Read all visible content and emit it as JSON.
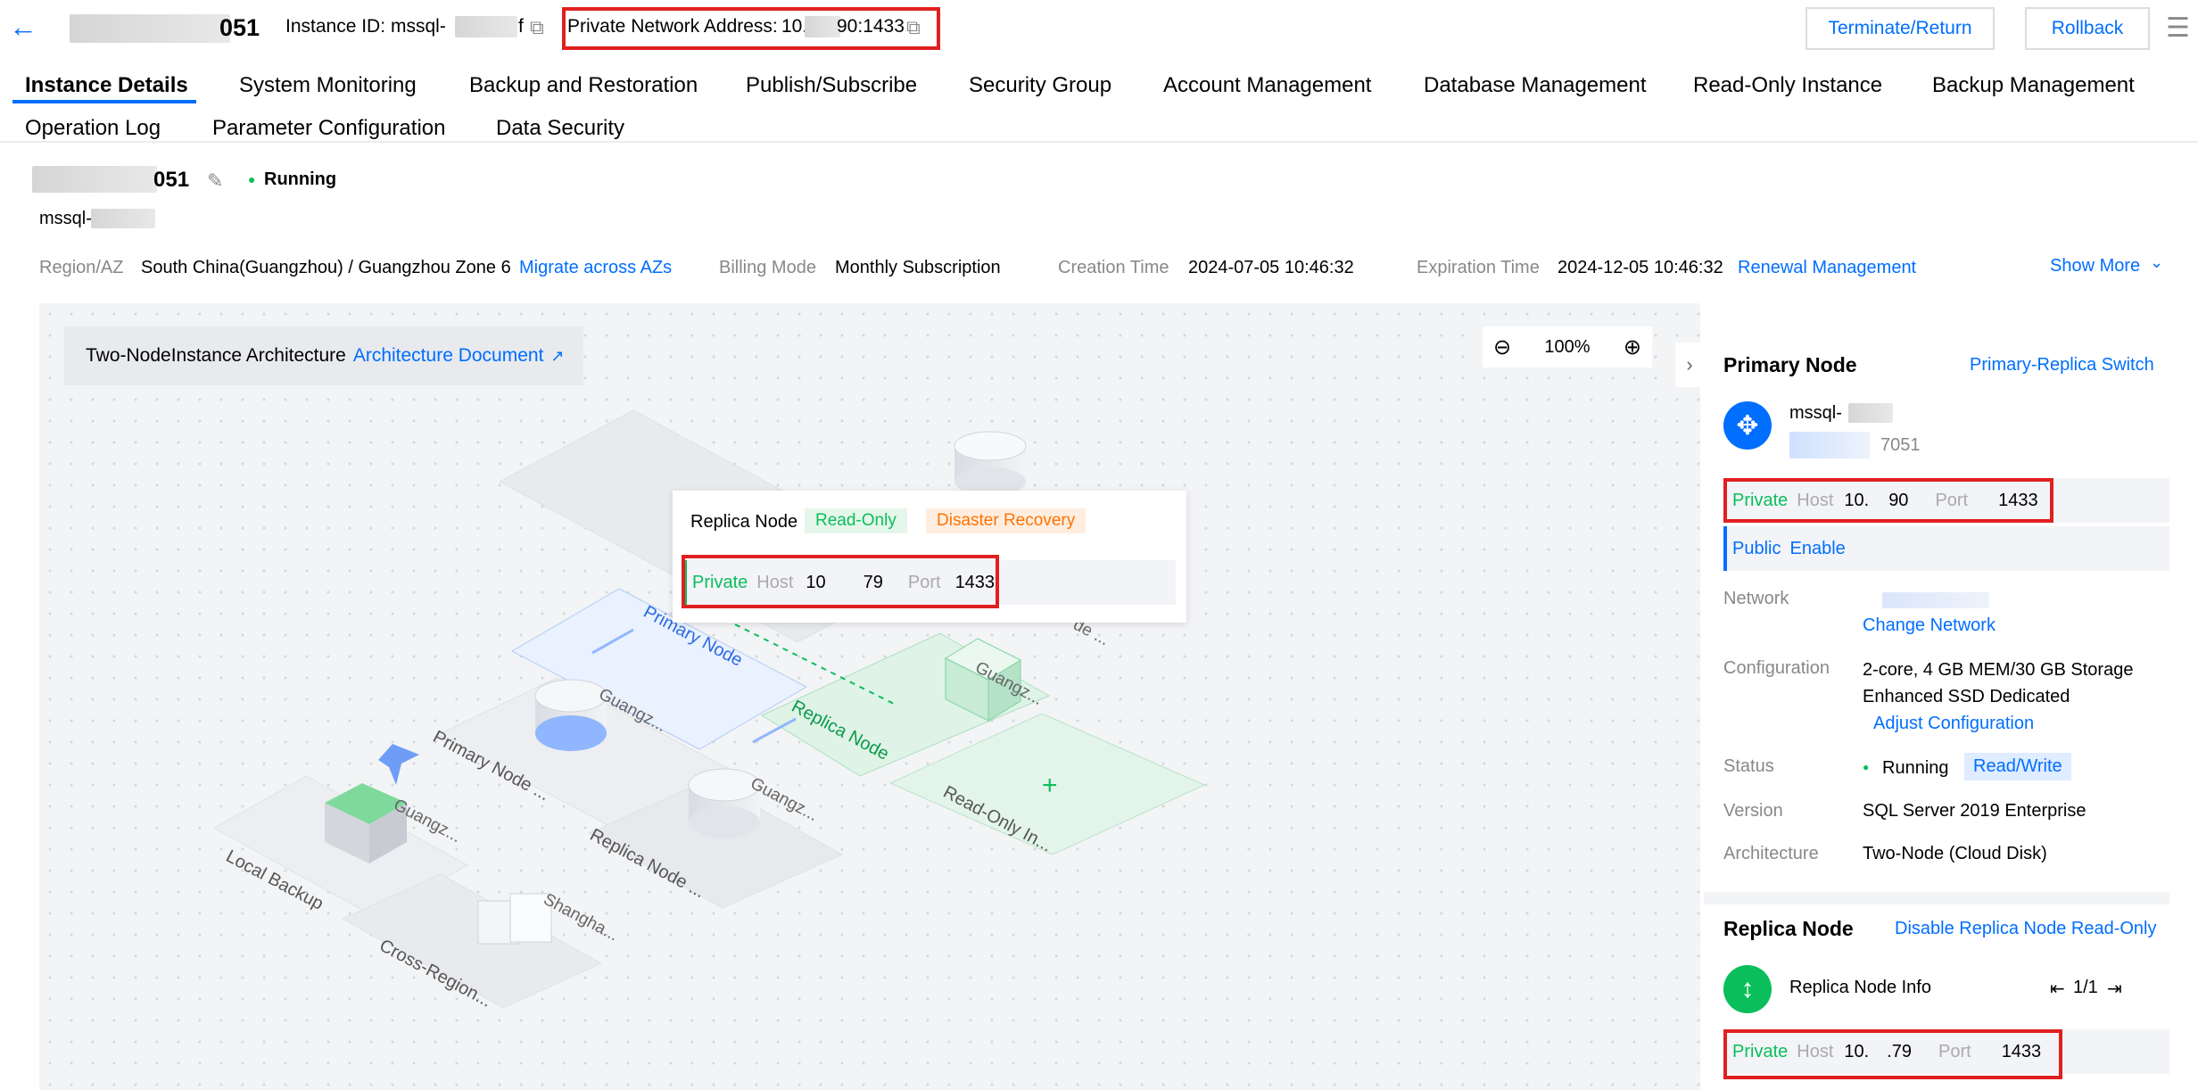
{
  "header": {
    "instance_name": "051",
    "instance_id_label": "Instance ID:",
    "instance_id_value": "mssql-",
    "instance_id_tail": "f",
    "private_address_label": "Private Network Address:",
    "private_address_prefix": "10.",
    "private_address_suffix": "90:1433",
    "terminate_button": "Terminate/Return",
    "rollback_button": "Rollback"
  },
  "tabs": [
    {
      "label": "Instance Details",
      "active": true
    },
    {
      "label": "System Monitoring"
    },
    {
      "label": "Backup and Restoration"
    },
    {
      "label": "Publish/Subscribe"
    },
    {
      "label": "Security Group"
    },
    {
      "label": "Account Management"
    },
    {
      "label": "Database Management"
    },
    {
      "label": "Read-Only Instance"
    },
    {
      "label": "Backup Management"
    },
    {
      "label": "Operation Log"
    },
    {
      "label": "Parameter Configuration"
    },
    {
      "label": "Data Security"
    }
  ],
  "summary": {
    "name_suffix": "051",
    "status": "Running",
    "sub_id": "mssql-",
    "region_label": "Region/AZ",
    "region_value": "South China(Guangzhou) / Guangzhou Zone 6",
    "migrate_link": "Migrate across AZs",
    "billing_label": "Billing Mode",
    "billing_value": "Monthly Subscription",
    "creation_label": "Creation Time",
    "creation_value": "2024-07-05 10:46:32",
    "expiration_label": "Expiration Time",
    "expiration_value": "2024-12-05 10:46:32",
    "renewal_link": "Renewal Management",
    "show_more": "Show More"
  },
  "diagram": {
    "arch_title": "Two-NodeInstance Architecture",
    "arch_doc_link": "Architecture Document",
    "zoom_level": "100%",
    "labels": {
      "primary_node": "Primary Node",
      "replica_node": "Replica Node",
      "primary_node_short": "Primary Node ...",
      "replica_node_short": "Replica Node ...",
      "readonly_short": "Read-Only In...",
      "local_backup": "Local Backup",
      "cross_region": "Cross-Region...",
      "guangz_1": "Guangz...",
      "guangz_2": "Guangz...",
      "guangz_3": "Guangz...",
      "guangz_4": "Guangz...",
      "shangha": "Shangha...",
      "node_short": "de ..."
    },
    "popup": {
      "title": "Replica Node",
      "tag_readonly": "Read-Only",
      "tag_dr": "Disaster Recovery",
      "private_label": "Private",
      "host_label": "Host",
      "host_prefix": "10",
      "host_suffix": "79",
      "port_label": "Port",
      "port_value": "1433"
    }
  },
  "primary_node": {
    "title": "Primary Node",
    "switch_link": "Primary-Replica Switch",
    "name_prefix": "mssql-",
    "name_suffix": "7051",
    "private_label": "Private",
    "host_label": "Host",
    "host_prefix": "10.",
    "host_suffix": "90",
    "port_label": "Port",
    "port_value": "1433",
    "public_label": "Public",
    "enable_link": "Enable",
    "network_label": "Network",
    "change_network_link": "Change Network",
    "configuration_label": "Configuration",
    "configuration_line1": "2-core, 4 GB MEM/30 GB Storage",
    "configuration_line2": "Enhanced SSD Dedicated",
    "adjust_link": "Adjust Configuration",
    "status_label": "Status",
    "status_value": "Running",
    "status_tag": "Read/Write",
    "version_label": "Version",
    "version_value": "SQL Server 2019 Enterprise",
    "architecture_label": "Architecture",
    "architecture_value": "Two-Node (Cloud Disk)"
  },
  "replica_node": {
    "title": "Replica Node",
    "disable_link": "Disable Replica Node Read-Only",
    "info_label": "Replica Node Info",
    "pager": "1/1",
    "private_label": "Private",
    "host_label": "Host",
    "host_prefix": "10.",
    "host_suffix": ".79",
    "port_label": "Port",
    "port_value": "1433"
  },
  "colors": {
    "accent": "#006eff",
    "success": "#0abf5b",
    "warning": "#ff7200",
    "highlight": "#e02020"
  }
}
